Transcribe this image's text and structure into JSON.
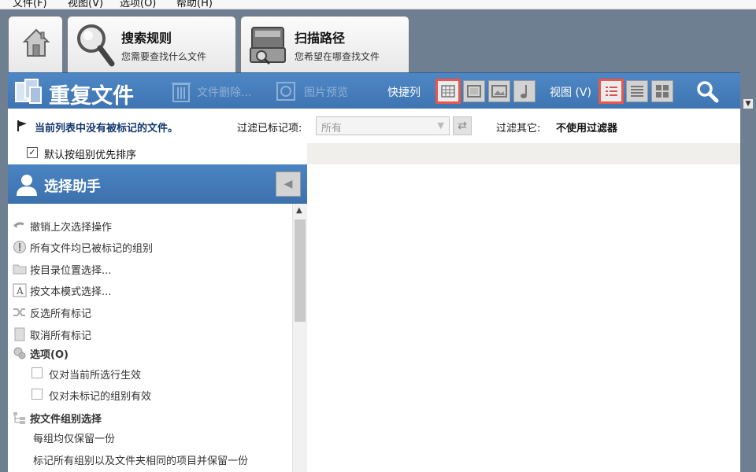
{
  "menu": [
    "文件(F)",
    "视图(V)",
    "选项(O)",
    "帮助(H)"
  ],
  "tabs": {
    "home_icon": "house-icon",
    "search": {
      "title": "搜索规则",
      "subtitle": "您需要查找什么文件",
      "icon": "magnifier-icon"
    },
    "scan": {
      "title": "扫描路径",
      "subtitle": "您希望在哪查找文件",
      "icon": "scanner-icon"
    }
  },
  "toolbar": {
    "title": "重复文件",
    "delete_label": "文件删除...",
    "preview_label": "图片预览",
    "quickcol_label": "快捷列",
    "view_label": "视图 (V)"
  },
  "filter": {
    "no_marked": "当前列表中没有被标记的文件。",
    "filter_marked_label": "过滤已标记项:",
    "filter_marked_value": "所有",
    "filter_other_label": "过滤其它:",
    "filter_other_value": "不使用过滤器"
  },
  "sort": {
    "checked": true,
    "label": "默认按组别优先排序"
  },
  "assistant": {
    "title": "选择助手",
    "items": [
      {
        "label": "撤销上次选择操作",
        "icon": "undo-icon"
      },
      {
        "label": "所有文件均已被标记的组别",
        "icon": "exclamation-icon"
      },
      {
        "label": "按目录位置选择...",
        "icon": "folder-icon"
      },
      {
        "label": "按文本模式选择...",
        "icon": "text-a-icon"
      },
      {
        "label": "反选所有标记",
        "icon": "shuffle-icon"
      },
      {
        "label": "取消所有标记",
        "icon": "page-icon"
      }
    ],
    "options_header": "选项(O)",
    "options": [
      {
        "label": "仅对当前所选行生效",
        "checked": false
      },
      {
        "label": "仅对未标记的组别有效",
        "checked": false
      }
    ],
    "group_header": "按文件组别选择",
    "group_items": [
      "每组均仅保留一份",
      "标记所有组别以及文件夹相同的项目并保留一份"
    ]
  }
}
